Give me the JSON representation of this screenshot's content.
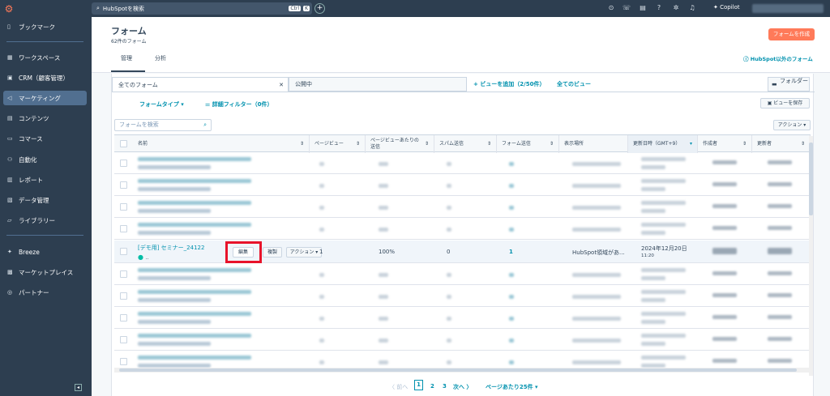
{
  "topbar": {
    "search_placeholder": "HubSpotを検索",
    "shortcut_ctrl": "Ctrl",
    "shortcut_k": "K",
    "copilot": "Copilot"
  },
  "sidebar": {
    "items": [
      {
        "label": "ブックマーク",
        "icon": "bookmark-icon"
      },
      {
        "label": "ワークスペース",
        "icon": "grid-icon"
      },
      {
        "label": "CRM（顧客管理）",
        "icon": "crm-icon"
      },
      {
        "label": "マーケティング",
        "icon": "megaphone-icon"
      },
      {
        "label": "コンテンツ",
        "icon": "content-icon"
      },
      {
        "label": "コマース",
        "icon": "commerce-icon"
      },
      {
        "label": "自動化",
        "icon": "automation-icon"
      },
      {
        "label": "レポート",
        "icon": "report-icon"
      },
      {
        "label": "データ管理",
        "icon": "database-icon"
      },
      {
        "label": "ライブラリー",
        "icon": "folder-icon"
      },
      {
        "label": "Breeze",
        "icon": "breeze-icon"
      },
      {
        "label": "マーケットプレイス",
        "icon": "store-icon"
      },
      {
        "label": "パートナー",
        "icon": "partner-icon"
      }
    ]
  },
  "header": {
    "title": "フォーム",
    "subtitle": "62件のフォーム",
    "create_button": "フォームを作成",
    "tabs": [
      "管理",
      "分析"
    ],
    "external_link": "HubSpot以外のフォーム"
  },
  "views": {
    "all_forms": "全てのフォーム",
    "published": "公開中",
    "add_view": "ビューを追加（2/50件）",
    "all_views": "全てのビュー",
    "folder": "フォルダー"
  },
  "filters": {
    "form_type": "フォームタイプ",
    "advanced": "詳細フィルター（0件）",
    "save_view": "ビューを保存",
    "search_placeholder": "フォームを検索",
    "actions": "アクション"
  },
  "table": {
    "columns": [
      "名前",
      "ページビュー",
      "ページビューあたりの送信",
      "スパム送信",
      "フォーム送信",
      "表示場所",
      "更新日時（GMT+9）",
      "作成者",
      "更新者"
    ],
    "highlight_row": {
      "name": "[デモ用] セミナー_24122",
      "edit": "編集",
      "clone": "複製",
      "actions": "アクション",
      "pageviews": "1",
      "rate": "100%",
      "spam": "0",
      "submissions": "1",
      "location": "HubSpot領域があ...",
      "date": "2024年12月20日",
      "time": "11:20"
    }
  },
  "pager": {
    "prev": "前へ",
    "pages": [
      "1",
      "2",
      "3"
    ],
    "next": "次へ",
    "per_page": "ページあたり25件"
  }
}
